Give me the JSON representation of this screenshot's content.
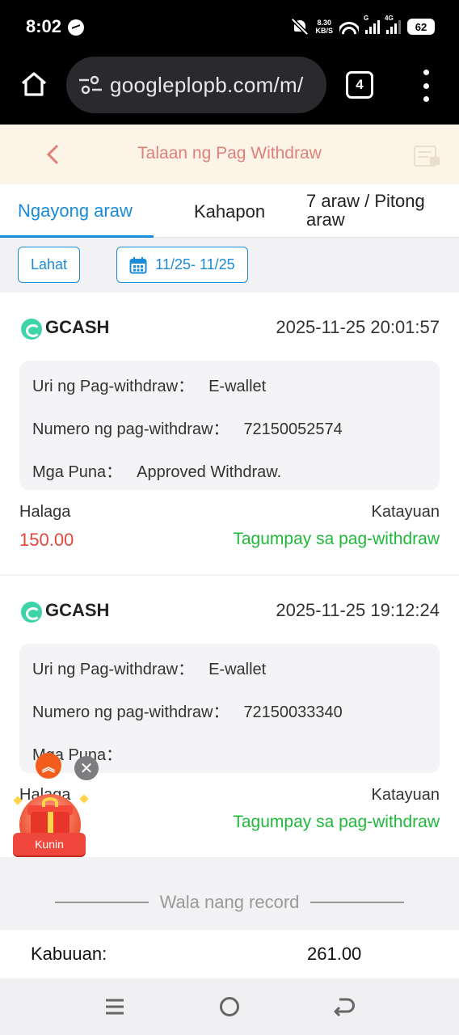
{
  "status_bar": {
    "time": "8:02",
    "speed_value": "8.30",
    "speed_unit": "KB/S",
    "network_1": "G",
    "network_2": "4G",
    "battery": "62"
  },
  "browser": {
    "url": "googleplopb.com/m/",
    "tab_count": "4"
  },
  "header": {
    "title": "Talaan ng Pag Withdraw"
  },
  "tabs": [
    {
      "label": "Ngayong araw",
      "active": true
    },
    {
      "label": "Kahapon",
      "active": false
    },
    {
      "label": "7 araw / Pitong araw",
      "active": false
    }
  ],
  "filters": {
    "all_label": "Lahat",
    "date_range": "11/25- 11/25"
  },
  "labels": {
    "type": "Uri ng Pag-withdraw：",
    "number": "Numero ng pag-withdraw：",
    "remarks": "Mga Puna：",
    "amount": "Halaga",
    "status": "Katayuan"
  },
  "records": [
    {
      "method": "GCASH",
      "datetime": "2025-11-25 20:01:57",
      "type": "E-wallet",
      "number": "72150052574",
      "remarks": "Approved Withdraw.",
      "amount": "150.00",
      "status": "Tagumpay sa pag-withdraw"
    },
    {
      "method": "GCASH",
      "datetime": "2025-11-25 19:12:24",
      "type": "E-wallet",
      "number": "72150033340",
      "remarks": "",
      "amount": "",
      "status": "Tagumpay sa pag-withdraw"
    }
  ],
  "floating": {
    "gift_button": "Kunin"
  },
  "footer": {
    "no_more": "Wala nang record",
    "total_label": "Kabuuan:",
    "total_value": "261.00"
  },
  "colors": {
    "accent": "#1a8bd6",
    "amount": "#e0483e",
    "success": "#1fb83a",
    "header_bg": "#fcf4e6",
    "header_title": "#e0807a"
  }
}
